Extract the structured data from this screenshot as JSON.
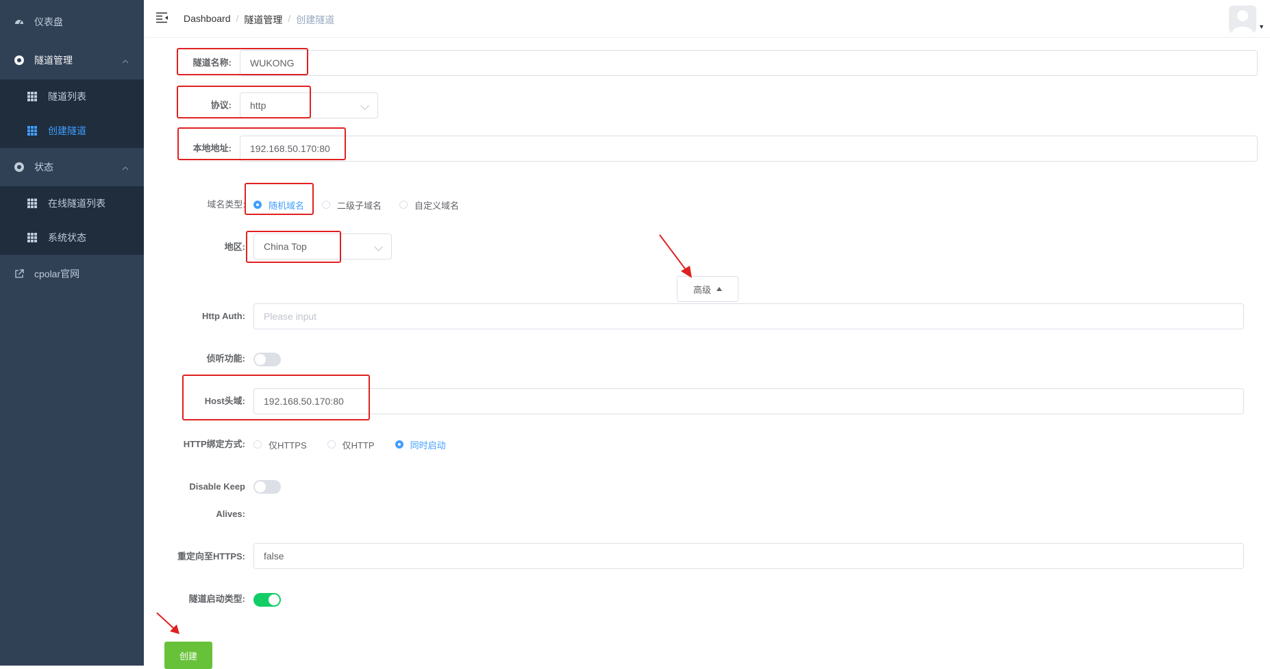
{
  "sidebar": {
    "dashboard": "仪表盘",
    "tunnel_mgmt": "隧道管理",
    "tunnel_list": "隧道列表",
    "create_tunnel": "创建隧道",
    "status": "状态",
    "online_tunnels": "在线隧道列表",
    "system_status": "系统状态",
    "cpolar_site": "cpolar官网"
  },
  "breadcrumb": {
    "home": "Dashboard",
    "sep": "/",
    "parent": "隧道管理",
    "current": "创建隧道"
  },
  "form": {
    "name_label": "隧道名称:",
    "name_value": "WUKONG",
    "protocol_label": "协议:",
    "protocol_value": "http",
    "local_label": "本地地址:",
    "local_value": "192.168.50.170:80",
    "domain_type_label": "域名类型:",
    "domain_types": [
      "随机域名",
      "二级子域名",
      "自定义域名"
    ],
    "region_label": "地区:",
    "region_value": "China Top",
    "advanced_label": "高级",
    "auth_label": "Http Auth:",
    "auth_placeholder": "Please input",
    "inspect_label": "侦听功能:",
    "host_label": "Host头域:",
    "host_value": "192.168.50.170:80",
    "bind_label": "HTTP绑定方式:",
    "bind_options": [
      "仅HTTPS",
      "仅HTTP",
      "同时启动"
    ],
    "keepalive_label_1": "Disable Keep",
    "keepalive_label_2": "Alives:",
    "redirect_label": "重定向至HTTPS:",
    "redirect_value": "false",
    "autostart_label": "隧道启动类型:",
    "create_button": "创建"
  },
  "state": {
    "domain_type_selected": "随机域名",
    "bind_selected": "同时启动",
    "inspect_on": false,
    "keepalive_disabled": false,
    "autostart_on": true
  },
  "colors": {
    "sidebar_bg": "#304156",
    "submenu_bg": "#1f2d3d",
    "accent": "#409eff",
    "success": "#13ce66",
    "button": "#67c23a",
    "annotation": "#e02020"
  }
}
